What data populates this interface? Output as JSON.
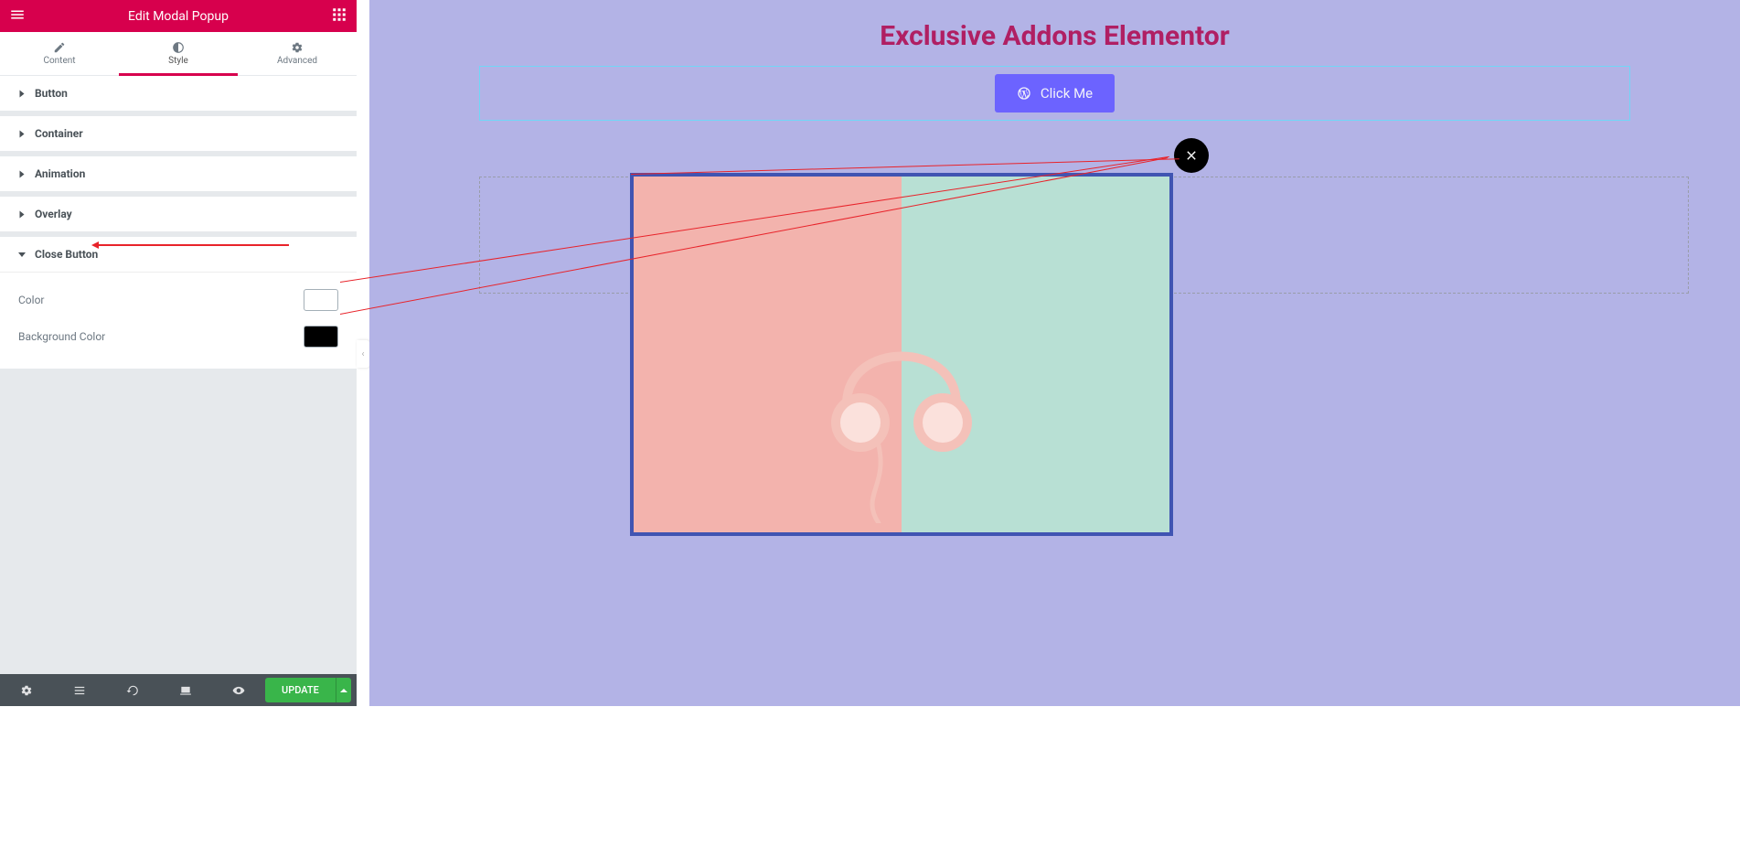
{
  "header": {
    "title": "Edit Modal Popup"
  },
  "tabs": [
    {
      "label": "Content"
    },
    {
      "label": "Style"
    },
    {
      "label": "Advanced"
    }
  ],
  "accordion": [
    {
      "label": "Button"
    },
    {
      "label": "Container"
    },
    {
      "label": "Animation"
    },
    {
      "label": "Overlay"
    },
    {
      "label": "Close Button"
    }
  ],
  "closeButton": {
    "colorLabel": "Color",
    "bgLabel": "Background Color"
  },
  "update": {
    "label": "UPDATE"
  },
  "page": {
    "title": "Exclusive Addons Elementor",
    "click": "Click Me"
  }
}
